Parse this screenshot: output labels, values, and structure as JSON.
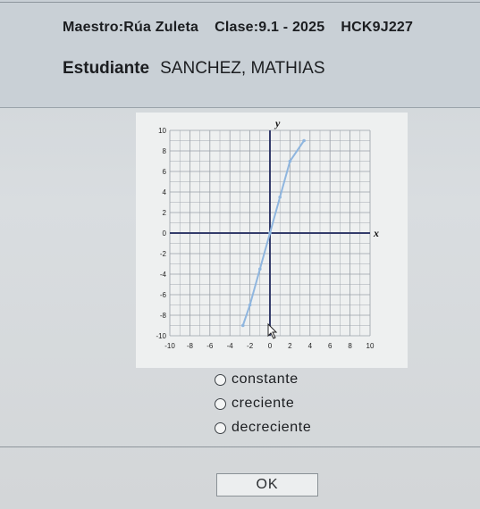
{
  "header": {
    "teacher": "Maestro:Rúa Zuleta",
    "class": "Clase:9.1 - 2025",
    "code": "HCK9J227"
  },
  "student": {
    "label": "Estudiante",
    "name": "SANCHEZ, MATHIAS"
  },
  "chart_data": {
    "type": "line",
    "xlabel": "x",
    "ylabel": "y",
    "xlim": [
      -10,
      10
    ],
    "ylim": [
      -10,
      10
    ],
    "xticks": [
      -10,
      -8,
      -6,
      -4,
      -2,
      0,
      2,
      4,
      6,
      8,
      10
    ],
    "yticks": [
      -10,
      -8,
      -6,
      -4,
      -2,
      0,
      2,
      4,
      6,
      8,
      10
    ],
    "grid": true,
    "series": [
      {
        "x": [
          -2.7,
          -2,
          -1,
          0,
          1,
          2,
          3.4
        ],
        "y": [
          -9,
          -7,
          -3.5,
          0,
          3.5,
          7,
          9
        ]
      }
    ]
  },
  "options": [
    {
      "label": "constante"
    },
    {
      "label": "creciente"
    },
    {
      "label": "decreciente"
    }
  ],
  "ok_label": "OK",
  "colors": {
    "line": "#8fb6df",
    "axis": "#343c6b",
    "grid": "#9aa0a8"
  }
}
